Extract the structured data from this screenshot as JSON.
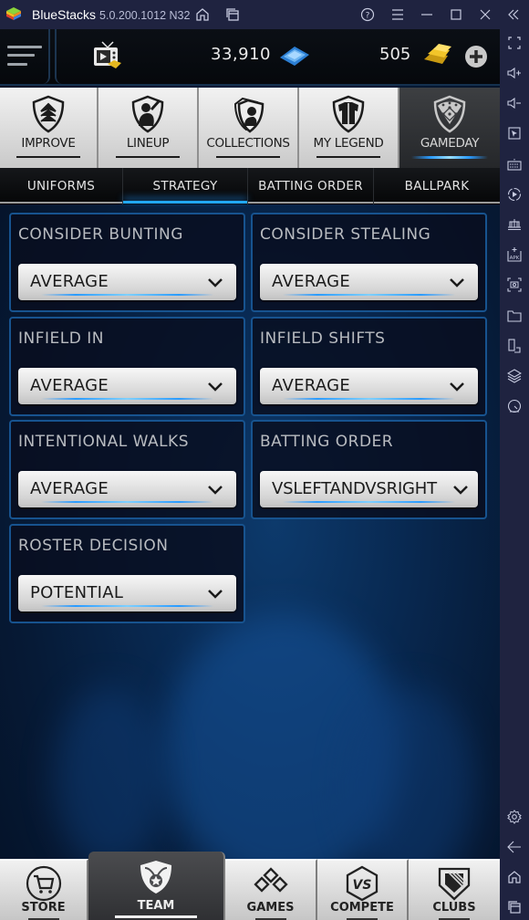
{
  "window": {
    "app_name": "BlueStacks",
    "version": "5.0.200.1012 N32",
    "icons": [
      "home-icon",
      "multi-instance-icon",
      "help-icon",
      "menu-icon",
      "minimize-icon",
      "maximize-icon",
      "close-icon",
      "collapse-sidebar-icon"
    ]
  },
  "sidebar": {
    "icons": [
      "fullscreen-icon",
      "volume-up-icon",
      "volume-down-icon",
      "pointer-icon",
      "keyboard-icon",
      "record-icon",
      "macro-icon",
      "install-apk-icon",
      "screenshot-icon",
      "folder-icon",
      "resize-icon",
      "layers-icon",
      "performance-icon",
      "settings-icon",
      "back-icon",
      "home-icon",
      "recents-icon"
    ]
  },
  "topbar": {
    "coins": "33,910",
    "gold": "505"
  },
  "nav": [
    {
      "label": "IMPROVE",
      "icon": "improve-shield-icon",
      "active": false
    },
    {
      "label": "LINEUP",
      "icon": "lineup-batter-icon",
      "active": false
    },
    {
      "label": "COLLECTIONS",
      "icon": "collections-shields-icon",
      "active": false
    },
    {
      "label": "MY LEGEND",
      "icon": "jersey-shield-icon",
      "active": false
    },
    {
      "label": "GAMEDAY",
      "icon": "baseball-field-icon",
      "active": true
    }
  ],
  "subtabs": [
    {
      "label": "UNIFORMS",
      "active": false
    },
    {
      "label": "STRATEGY",
      "active": true
    },
    {
      "label": "BATTING ORDER",
      "active": false
    },
    {
      "label": "BALLPARK",
      "active": false
    }
  ],
  "strategy": [
    {
      "title": "CONSIDER BUNTING",
      "value": "AVERAGE"
    },
    {
      "title": "CONSIDER STEALING",
      "value": "AVERAGE"
    },
    {
      "title": "INFIELD IN",
      "value": "AVERAGE"
    },
    {
      "title": "INFIELD SHIFTS",
      "value": "AVERAGE"
    },
    {
      "title": "INTENTIONAL WALKS",
      "value": "AVERAGE"
    },
    {
      "title": "BATTING ORDER",
      "value": "VSLEFTANDVSRIGHT"
    },
    {
      "title": "ROSTER DECISION",
      "value": "POTENTIAL"
    }
  ],
  "bottom_nav": [
    {
      "label": "STORE",
      "active": false
    },
    {
      "label": "TEAM",
      "active": true
    },
    {
      "label": "GAMES",
      "active": false
    },
    {
      "label": "COMPETE",
      "active": false
    },
    {
      "label": "CLUBS",
      "active": false
    }
  ],
  "colors": {
    "accent": "#22a8ff",
    "panel_border": "#17538f",
    "window_chrome": "#1f2340"
  }
}
